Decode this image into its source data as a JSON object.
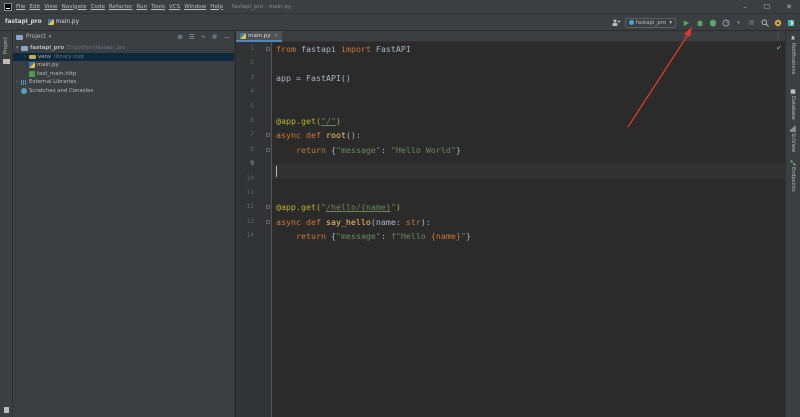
{
  "menu": [
    "File",
    "Edit",
    "View",
    "Navigate",
    "Code",
    "Refactor",
    "Run",
    "Tools",
    "VCS",
    "Window",
    "Help"
  ],
  "window_title": "fastapi_pro - main.py",
  "window_controls": [
    "–",
    "☐",
    "✕"
  ],
  "breadcrumb": {
    "project": "fastapi_pro",
    "file": "main.py"
  },
  "run_config": "fastapi_pro",
  "project_panel": {
    "title": "Project",
    "tree": [
      {
        "label": "fastapi_pro",
        "path": "D:\\python\\fastapi_pro",
        "depth": 0,
        "expanded": true,
        "icon": "folder-icon"
      },
      {
        "label": "venv",
        "path": "library root",
        "depth": 1,
        "expanded": false,
        "icon": "folder-icon",
        "selected": true
      },
      {
        "label": "main.py",
        "depth": 1,
        "icon": "python-file-icon"
      },
      {
        "label": "test_main.http",
        "depth": 1,
        "icon": "http-file-icon"
      },
      {
        "label": "External Libraries",
        "depth": 0,
        "expanded": false,
        "icon": "library-icon"
      },
      {
        "label": "Scratches and Consoles",
        "depth": 0,
        "icon": "scratch-icon"
      }
    ]
  },
  "left_stripe": {
    "label": "Project"
  },
  "editor": {
    "tab": "main.py",
    "current_line": 9,
    "line_numbers": [
      "1",
      "2",
      "3",
      "4",
      "5",
      "6",
      "7",
      "8",
      "9",
      "10",
      "11",
      "12",
      "13",
      "14"
    ]
  },
  "code": {
    "l1": [
      "from",
      " fastapi ",
      "import",
      " FastAPI"
    ],
    "l3": "app = FastAPI()",
    "l6": [
      "@app.get(",
      "\"/\"",
      ")"
    ],
    "l7": [
      "async def ",
      "root",
      "():"
    ],
    "l8": [
      "    ",
      "return",
      " {",
      "\"message\"",
      ": ",
      "\"Hello World\"",
      "}"
    ],
    "l11": [
      "@app.get(",
      "\"",
      "/hello/{name}",
      "\"",
      ")"
    ],
    "l12": [
      "async def ",
      "say_hello",
      "(name: ",
      "str",
      "):"
    ],
    "l13": [
      "    ",
      "return",
      " {",
      "\"message\"",
      ": ",
      "f\"Hello ",
      "{name}",
      "\"",
      "}"
    ]
  },
  "right_stripe": [
    "Notifications",
    "Database",
    "SciView",
    "Endpoints"
  ],
  "colors": {
    "background": "#2b2b2b",
    "panel": "#3c3f41",
    "keyword": "#cc7832",
    "string": "#6a8759",
    "function": "#ffc66d",
    "decorator": "#bbb529",
    "run_green": "#59a869",
    "annotation_arrow": "#e0392b"
  }
}
